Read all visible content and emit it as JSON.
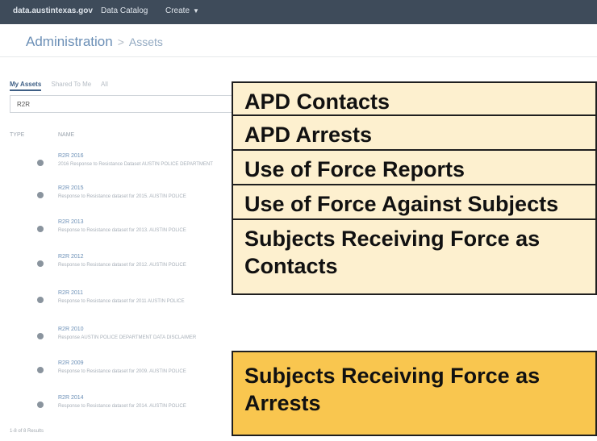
{
  "topbar": {
    "brand": "data.austintexas.gov",
    "catalog": "Data Catalog",
    "create": "Create"
  },
  "breadcrumb": {
    "root": "Administration",
    "separator": ">",
    "current": "Assets"
  },
  "tabs": [
    "My Assets",
    "Shared To Me",
    "All"
  ],
  "search": {
    "value": "R2R"
  },
  "table": {
    "headers": {
      "type": "TYPE",
      "name": "NAME"
    },
    "rows": [
      {
        "title": "R2R 2016",
        "desc": "2016 Response to Resistance Dataset AUSTIN POLICE DEPARTMENT"
      },
      {
        "title": "R2R 2015",
        "desc": "Response to Resistance dataset for 2015. AUSTIN POLICE"
      },
      {
        "title": "R2R 2013",
        "desc": "Response to Resistance dataset for 2013. AUSTIN POLICE"
      },
      {
        "title": "R2R 2012",
        "desc": "Response to Resistance dataset for 2012. AUSTIN POLICE"
      },
      {
        "title": "R2R 2011",
        "desc": "Response to Resistance dataset for 2011 AUSTIN POLICE"
      },
      {
        "title": "R2R 2010",
        "desc": "Response AUSTIN POLICE DEPARTMENT DATA DISCLAIMER"
      },
      {
        "title": "R2R 2009",
        "desc": "Response to Resistance dataset for 2009. AUSTIN POLICE"
      },
      {
        "title": "R2R 2014",
        "desc": "Response to Resistance dataset for 2014. AUSTIN POLICE"
      }
    ],
    "footer": "1-8 of 8 Results"
  },
  "overlay": {
    "items": [
      {
        "label": "APD Contacts"
      },
      {
        "label": "APD Arrests"
      },
      {
        "label": "Use of Force Reports"
      },
      {
        "label": "Use of Force Against Subjects"
      },
      {
        "label": "Subjects Receiving Force as Contacts"
      },
      {
        "label": "Subjects Receiving Force as Arrests"
      }
    ]
  },
  "colors": {
    "topbar": "#3e4b5a",
    "overlay_bg": "#fdf0cf",
    "overlay_active": "#f9c64f",
    "link": "#6b8fb6"
  }
}
